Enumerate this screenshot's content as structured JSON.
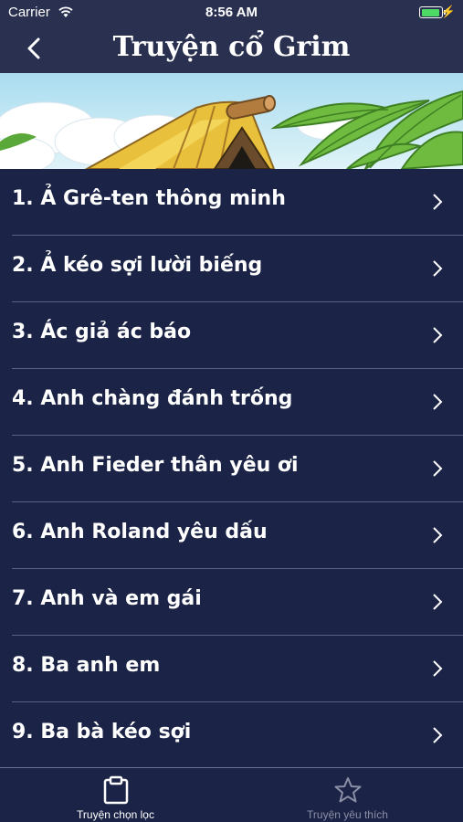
{
  "status_bar": {
    "carrier": "Carrier",
    "time": "8:56 AM",
    "wifi_icon": "wifi-icon",
    "battery_icon": "battery-icon",
    "battery_level": 0.8,
    "charging_icon": "bolt-icon"
  },
  "nav": {
    "title": "Truyện cổ Grim",
    "back_icon": "back-chevron-icon"
  },
  "stories": [
    {
      "label": "1. Ả Grê-ten thông minh"
    },
    {
      "label": "2. Ả kéo sợi lười biếng"
    },
    {
      "label": "3. Ác giả ác báo"
    },
    {
      "label": "4. Anh chàng đánh trống"
    },
    {
      "label": "5. Anh Fieder thân yêu ơi"
    },
    {
      "label": "6. Anh Roland yêu dấu"
    },
    {
      "label": "7. Anh và em gái"
    },
    {
      "label": "8. Ba anh em"
    },
    {
      "label": "9. Ba bà kéo sợi"
    }
  ],
  "tabs": [
    {
      "label": "Truyện chọn lọc",
      "icon": "clipboard-icon",
      "active": true
    },
    {
      "label": "Truyện yêu thích",
      "icon": "star-icon",
      "active": false
    }
  ],
  "colors": {
    "nav_background": "#2a3150",
    "list_background": "#1b2346",
    "divider": "#5a6180",
    "active_tab": "#ffffff",
    "inactive_tab": "#8a8fa6"
  }
}
